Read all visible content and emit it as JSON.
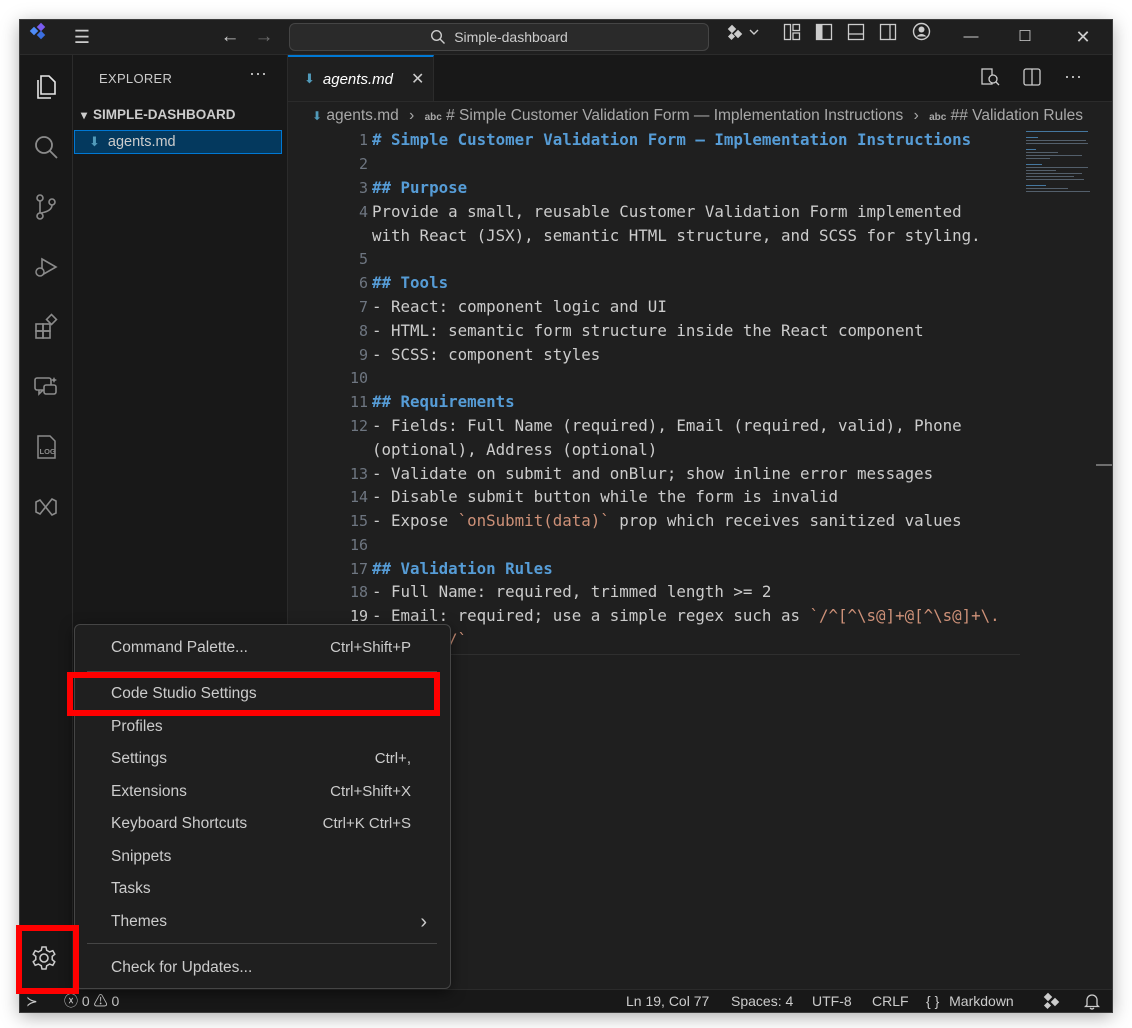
{
  "title_bar": {
    "search_text": "Simple-dashboard"
  },
  "sidebar": {
    "title": "EXPLORER",
    "more": "···",
    "folder": "SIMPLE-DASHBOARD",
    "file": "agents.md"
  },
  "tab": {
    "label": "agents.md"
  },
  "breadcrumb": {
    "file": "agents.md",
    "heading": "# Simple Customer Validation Form — Implementation Instructions",
    "section": "## Validation Rules"
  },
  "editor": {
    "line_numbers": [
      "1",
      "2",
      "3",
      "4",
      "",
      "5",
      "6",
      "7",
      "8",
      "9",
      "10",
      "11",
      "12",
      "",
      "13",
      "14",
      "15",
      "16",
      "17",
      "18",
      "19",
      ""
    ],
    "current_line": "19",
    "lines": {
      "l1": "# Simple Customer Validation Form — Implementation Instructions",
      "l3": "## Purpose",
      "l4a": "Provide a small, reusable Customer Validation Form implemented",
      "l4b": "with React (JSX), semantic HTML structure, and SCSS for styling.",
      "l6": "## Tools",
      "l7": "- React: component logic and UI",
      "l8": "- HTML: semantic form structure inside the React component",
      "l9": "- SCSS: component styles",
      "l11": "## Requirements",
      "l12a": "- Fields: Full Name (required), Email (required, valid), Phone",
      "l12b": "(optional), Address (optional)",
      "l13": "- Validate on submit and onBlur; show inline error messages",
      "l14": "- Disable submit button while the form is invalid",
      "l15_pre": "- Expose ",
      "l15_code": "`onSubmit(data)`",
      "l15_post": " prop which receives sanitized values",
      "l17": "## Validation Rules",
      "l18": "- Full Name: required, trimmed length >= 2",
      "l19_pre": "- Email: required; use a simple regex such as ",
      "l19_code": "`/^[^\\s@]+@[^\\s@]+\\.",
      "l19_cont": "/`"
    }
  },
  "menu": {
    "items": [
      {
        "label": "Command Palette...",
        "shortcut": "Ctrl+Shift+P"
      },
      {
        "label": "Code Studio Settings",
        "shortcut": ""
      },
      {
        "label": "Profiles",
        "shortcut": ""
      },
      {
        "label": "Settings",
        "shortcut": "Ctrl+,"
      },
      {
        "label": "Extensions",
        "shortcut": "Ctrl+Shift+X"
      },
      {
        "label": "Keyboard Shortcuts",
        "shortcut": "Ctrl+K Ctrl+S"
      },
      {
        "label": "Snippets",
        "shortcut": ""
      },
      {
        "label": "Tasks",
        "shortcut": ""
      },
      {
        "label": "Themes",
        "shortcut": "›"
      },
      {
        "label": "Check for Updates...",
        "shortcut": ""
      }
    ]
  },
  "status_bar": {
    "errors": "0",
    "warnings": "0",
    "position": "Ln 19, Col 77",
    "spaces": "Spaces: 4",
    "encoding": "UTF-8",
    "eol": "CRLF",
    "language_icon": "{ }",
    "language": "Markdown"
  },
  "activity_icons": [
    "explorer-icon",
    "search-icon",
    "source-control-icon",
    "run-debug-icon",
    "extensions-icon",
    "chat-icon",
    "log-icon",
    "visual-studio-icon",
    "gear-icon"
  ],
  "colors": {
    "accent": "#0078d4",
    "heading": "#569cd6",
    "inline_code": "#ce9178",
    "highlight": "#ff0000"
  }
}
